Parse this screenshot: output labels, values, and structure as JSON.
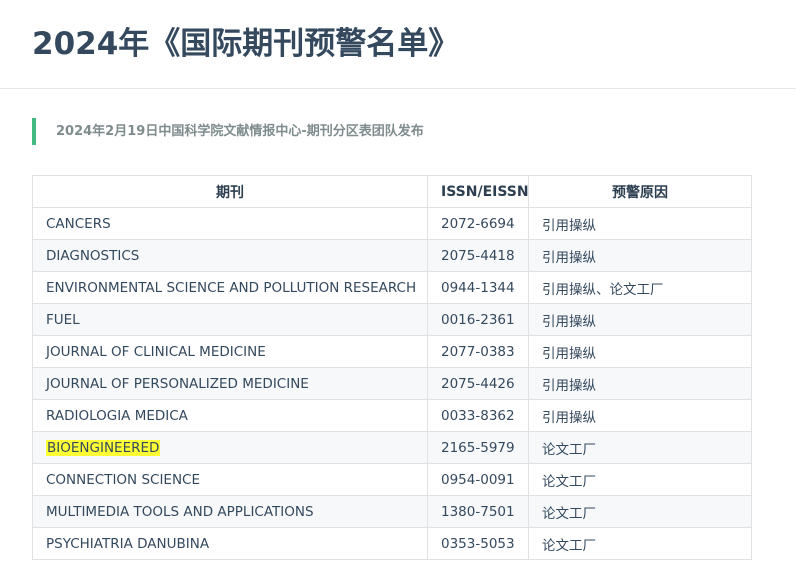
{
  "page": {
    "title": "2024年《国际期刊预警名单》",
    "notice": "2024年2月19日中国科学院文献情报中心-期刊分区表团队发布"
  },
  "table": {
    "headers": [
      "期刊",
      "ISSN/EISSN",
      "预警原因"
    ],
    "rows": [
      {
        "journal": "CANCERS",
        "issn": "2072-6694",
        "reason": "引用操纵",
        "highlighted": false
      },
      {
        "journal": "DIAGNOSTICS",
        "issn": "2075-4418",
        "reason": "引用操纵",
        "highlighted": false
      },
      {
        "journal": "ENVIRONMENTAL SCIENCE AND POLLUTION RESEARCH",
        "issn": "0944-1344",
        "reason": "引用操纵、论文工厂",
        "highlighted": false
      },
      {
        "journal": "FUEL",
        "issn": "0016-2361",
        "reason": "引用操纵",
        "highlighted": false
      },
      {
        "journal": "JOURNAL OF CLINICAL MEDICINE",
        "issn": "2077-0383",
        "reason": "引用操纵",
        "highlighted": false
      },
      {
        "journal": "JOURNAL OF PERSONALIZED MEDICINE",
        "issn": "2075-4426",
        "reason": "引用操纵",
        "highlighted": false
      },
      {
        "journal": "RADIOLOGIA MEDICA",
        "issn": "0033-8362",
        "reason": "引用操纵",
        "highlighted": false
      },
      {
        "journal": "BIOENGINEERED",
        "issn": "2165-5979",
        "reason": "论文工厂",
        "highlighted": true
      },
      {
        "journal": "CONNECTION SCIENCE",
        "issn": "0954-0091",
        "reason": "论文工厂",
        "highlighted": false
      },
      {
        "journal": "MULTIMEDIA TOOLS AND APPLICATIONS",
        "issn": "1380-7501",
        "reason": "论文工厂",
        "highlighted": false
      },
      {
        "journal": "PSYCHIATRIA DANUBINA",
        "issn": "0353-5053",
        "reason": "论文工厂",
        "highlighted": false
      }
    ]
  },
  "colors": {
    "title": "#34495e",
    "notice_bar": "#42b983",
    "notice_text": "#7f8c8d",
    "highlight": "#ffff33",
    "row_stripe": "#f6f8fa",
    "border": "#dfe2e5"
  }
}
